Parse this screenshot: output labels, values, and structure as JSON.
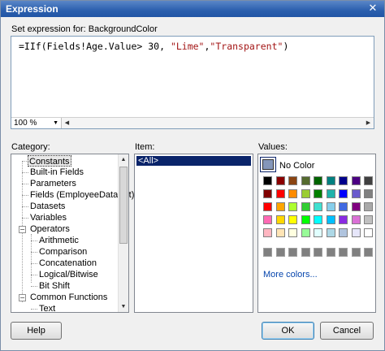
{
  "window": {
    "title": "Expression",
    "close_glyph": "✕"
  },
  "expression": {
    "label": "Set expression for: BackgroundColor",
    "code_prefix": "=IIf(Fields!Age.Value> 30, ",
    "code_str1": "\"Lime\"",
    "code_sep": ",",
    "code_str2": "\"Transparent\"",
    "code_suffix": ")",
    "zoom": "100 %"
  },
  "category": {
    "label": "Category:",
    "items": [
      "Constants",
      "Built-in Fields",
      "Parameters",
      "Fields (EmployeeDataSet)",
      "Datasets",
      "Variables",
      "Operators",
      "Arithmetic",
      "Comparison",
      "Concatenation",
      "Logical/Bitwise",
      "Bit Shift",
      "Common Functions",
      "Text"
    ]
  },
  "item": {
    "label": "Item:",
    "selected": "<All>"
  },
  "values": {
    "label": "Values:",
    "no_color": "No Color",
    "more_colors": "More colors...",
    "grid": [
      [
        "#000000",
        "#8b0000",
        "#8b4513",
        "#556b2f",
        "#006400",
        "#008080",
        "#00008b",
        "#4b0082",
        "#404040"
      ],
      [
        "#800000",
        "#ff0000",
        "#ff8c00",
        "#9acd32",
        "#008000",
        "#20b2aa",
        "#0000ff",
        "#6a5acd",
        "#808080"
      ],
      [
        "#ff0000",
        "#ffa500",
        "#adff2f",
        "#32cd32",
        "#40e0d0",
        "#87ceeb",
        "#4169e1",
        "#800080",
        "#a9a9a9"
      ],
      [
        "#ff69b4",
        "#ffd700",
        "#ffff00",
        "#00ff00",
        "#00ffff",
        "#00bfff",
        "#8a2be2",
        "#da70d6",
        "#c0c0c0"
      ],
      [
        "#ffb6c1",
        "#ffe4b5",
        "#ffffe0",
        "#98fb98",
        "#e0ffff",
        "#add8e6",
        "#b0c4de",
        "#e6e6fa",
        "#ffffff"
      ]
    ],
    "custom_row_color": "#808080"
  },
  "buttons": {
    "help": "Help",
    "ok": "OK",
    "cancel": "Cancel"
  }
}
